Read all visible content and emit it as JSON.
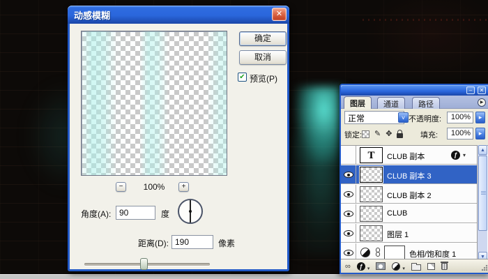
{
  "icons": {
    "close": "✕",
    "minimize": "–",
    "minus": "−",
    "plus": "+",
    "check": "✔",
    "combo_arrow": "˅",
    "flyout_arrow": "▸",
    "menu_arrow": "▶",
    "up_arrow": "▲",
    "down_arrow": "▼",
    "fx_glyph": "ƒ",
    "fx_dropdown": "▾",
    "brush": "✎",
    "move": "✥",
    "link": "∞",
    "text_thumb": "T"
  },
  "dialog": {
    "title": "动感模糊",
    "ok_label": "确定",
    "cancel_label": "取消",
    "preview_label": "预览(P)",
    "zoom_level": "100%",
    "angle_label": "角度(A):",
    "angle_value": "90",
    "angle_unit": "度",
    "distance_label": "距离(D):",
    "distance_value": "190",
    "distance_unit": "像素"
  },
  "panel": {
    "tabs": [
      "图层",
      "通道",
      "路径"
    ],
    "blend_mode": "正常",
    "opacity_label": "不透明度:",
    "opacity_value": "100%",
    "lock_label": "锁定:",
    "fill_label": "填充:",
    "fill_value": "100%",
    "layers": [
      {
        "name": "CLUB 副本",
        "type": "text",
        "visible": false,
        "selected": false,
        "has_fx": true
      },
      {
        "name": "CLUB 副本 3",
        "type": "pixel",
        "visible": true,
        "selected": true
      },
      {
        "name": "CLUB 副本 2",
        "type": "pixel",
        "visible": true,
        "selected": false
      },
      {
        "name": "CLUB",
        "type": "pixel",
        "visible": true,
        "selected": false
      },
      {
        "name": "图层 1",
        "type": "pixel",
        "visible": true,
        "selected": false
      },
      {
        "name": "色相/饱和度 1",
        "type": "adjustment",
        "visible": true,
        "selected": false
      }
    ],
    "toolbar_icons": [
      "link-layers",
      "layer-style",
      "add-layer-mask",
      "adjustment-layer",
      "new-group",
      "new-layer",
      "delete-layer"
    ]
  }
}
